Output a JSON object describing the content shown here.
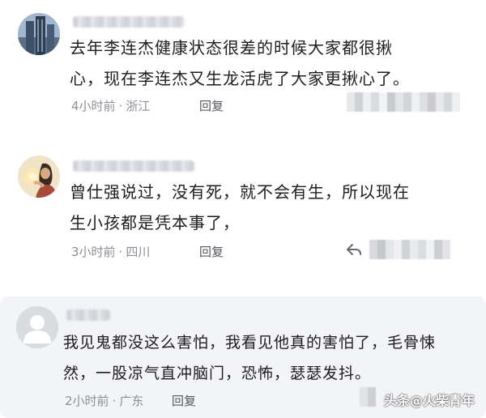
{
  "comments": [
    {
      "avatar_icon": "city-buildings-avatar",
      "text_lines": [
        "去年李连杰健康状态很差的时候大家都很揪",
        "心，现在李连杰又生龙活虎了大家更揪心了。"
      ],
      "time": "4小时前",
      "sep": "·",
      "location": "浙江",
      "reply_label": "回复"
    },
    {
      "avatar_icon": "woman-holding-light-avatar",
      "text_lines": [
        "曾仕强说过，没有死，就不会有生，所以现在",
        "生小孩都是凭本事了，"
      ],
      "time": "3小时前",
      "sep": "·",
      "location": "四川",
      "reply_label": "回复"
    },
    {
      "avatar_icon": "default-user-avatar",
      "text_lines": [
        "我见鬼都没这么害怕，我看见他真的害怕了，毛骨悚",
        "然，一股凉气直冲脑门，恐怖，瑟瑟发抖。"
      ],
      "time": "2小时前",
      "sep": "·",
      "location": "广东",
      "reply_label": "回复"
    }
  ],
  "watermark": "头条@火柴青年"
}
